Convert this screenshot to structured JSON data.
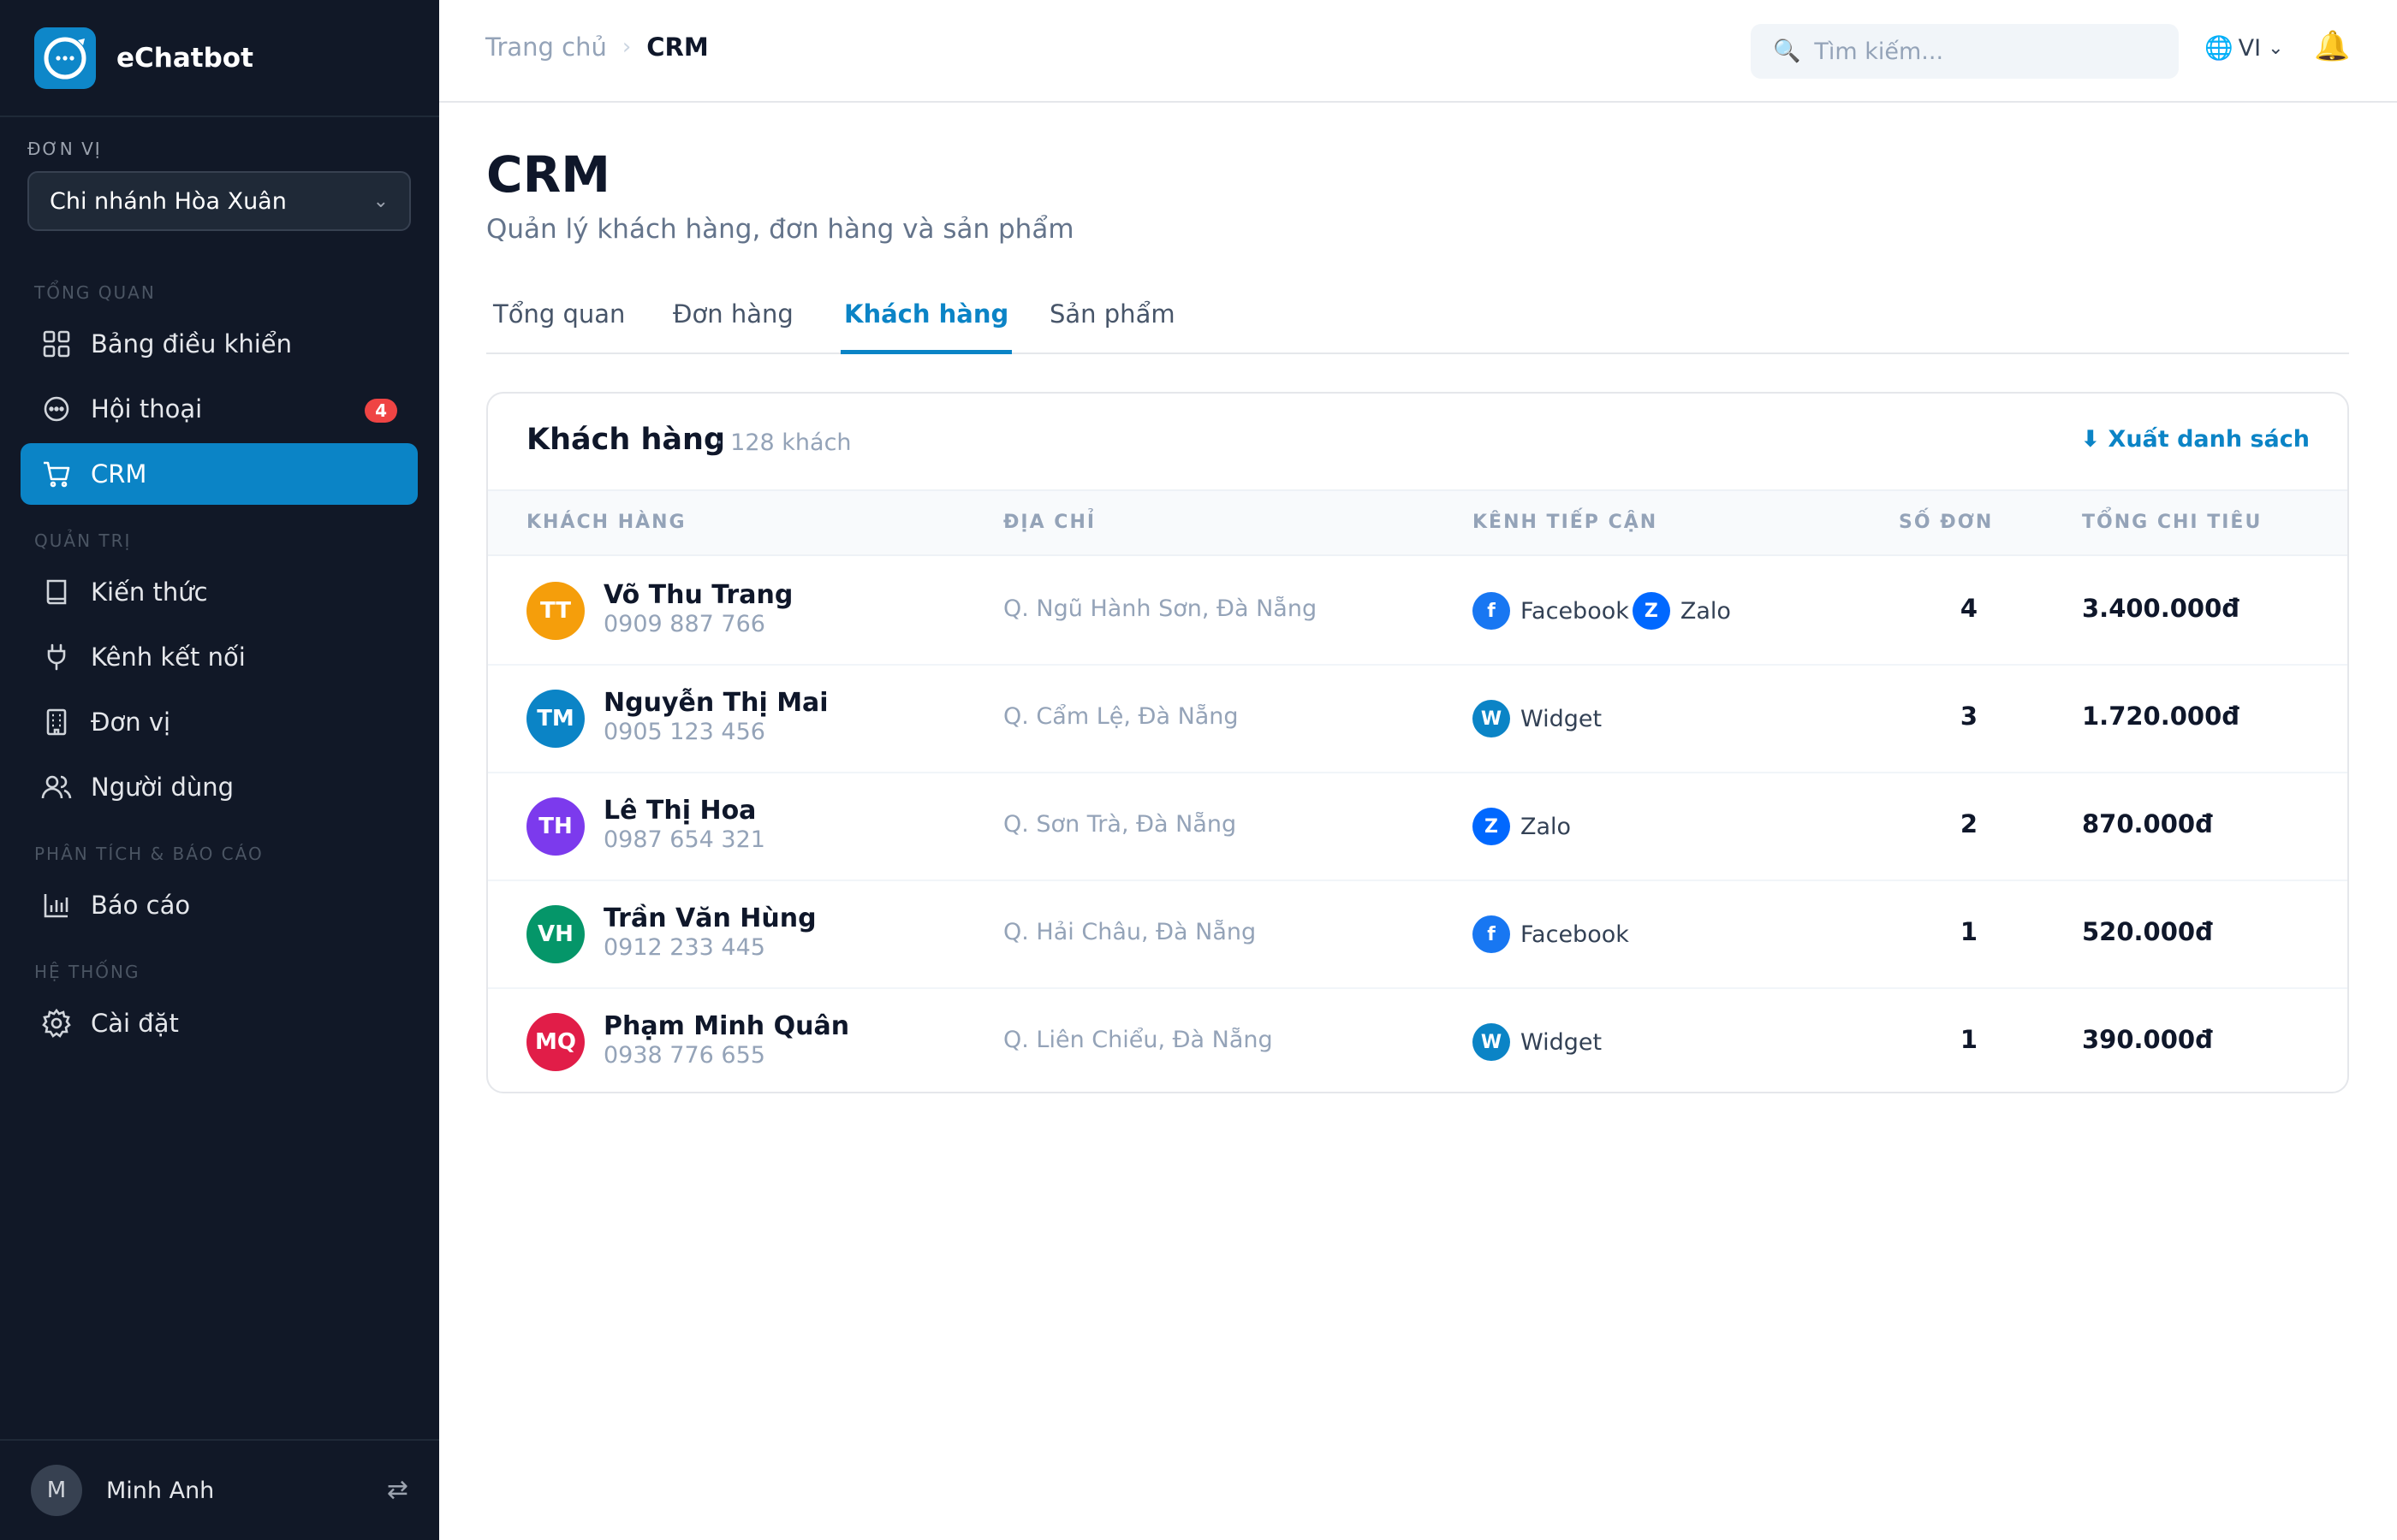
{
  "app": {
    "name": "eChatbot"
  },
  "sidebar": {
    "unit_label": "ĐƠN VỊ",
    "unit_value": "Chi nhánh Hòa Xuân",
    "sections": {
      "overview": "TỔNG QUAN",
      "admin": "QUẢN TRỊ",
      "analytics": "PHÂN TÍCH & BÁO CÁO",
      "system": "HỆ THỐNG"
    },
    "items": {
      "dashboard": "Bảng điều khiển",
      "conversations": "Hội thoại",
      "conversations_badge": "4",
      "crm": "CRM",
      "knowledge": "Kiến thức",
      "channels": "Kênh kết nối",
      "units": "Đơn vị",
      "users": "Người dùng",
      "reports": "Báo cáo",
      "settings": "Cài đặt"
    },
    "user": {
      "initial": "M",
      "name": "Minh Anh"
    }
  },
  "header": {
    "breadcrumb_home": "Trang chủ",
    "breadcrumb_current": "CRM",
    "search_placeholder": "Tìm kiếm...",
    "language": "VI"
  },
  "page": {
    "title": "CRM",
    "subtitle": "Quản lý khách hàng, đơn hàng và sản phẩm",
    "tabs": [
      "Tổng quan",
      "Đơn hàng",
      "Khách hàng",
      "Sản phẩm"
    ],
    "active_tab": "Khách hàng"
  },
  "customers": {
    "title": "Khách hàng",
    "count": "· 128 khách",
    "export_label": "⬇ Xuất danh sách",
    "columns": [
      "KHÁCH HÀNG",
      "ĐỊA CHỈ",
      "KÊNH TIẾP CẬN",
      "SỐ ĐƠN",
      "TỔNG CHI TIÊU"
    ],
    "rows": [
      {
        "initials": "TT",
        "avatar_color": "#f59e0b",
        "name": "Võ Thu Trang",
        "phone": "0909 887 766",
        "address": "Q. Ngũ Hành Sơn, Đà Nẵng",
        "channels": [
          "Facebook",
          "Zalo"
        ],
        "orders": "4",
        "total": "3.400.000đ"
      },
      {
        "initials": "TM",
        "avatar_color": "#0b84c6",
        "name": "Nguyễn Thị Mai",
        "phone": "0905 123 456",
        "address": "Q. Cẩm Lệ, Đà Nẵng",
        "channels": [
          "Widget"
        ],
        "orders": "3",
        "total": "1.720.000đ"
      },
      {
        "initials": "TH",
        "avatar_color": "#7c3aed",
        "name": "Lê Thị Hoa",
        "phone": "0987 654 321",
        "address": "Q. Sơn Trà, Đà Nẵng",
        "channels": [
          "Zalo"
        ],
        "orders": "2",
        "total": "870.000đ"
      },
      {
        "initials": "VH",
        "avatar_color": "#059669",
        "name": "Trần Văn Hùng",
        "phone": "0912 233 445",
        "address": "Q. Hải Châu, Đà Nẵng",
        "channels": [
          "Facebook"
        ],
        "orders": "1",
        "total": "520.000đ"
      },
      {
        "initials": "MQ",
        "avatar_color": "#e11d48",
        "name": "Phạm Minh Quân",
        "phone": "0938 776 655",
        "address": "Q. Liên Chiểu, Đà Nẵng",
        "channels": [
          "Widget"
        ],
        "orders": "1",
        "total": "390.000đ"
      }
    ]
  },
  "channel_styles": {
    "Facebook": {
      "letter": "f",
      "color": "#1877f2"
    },
    "Zalo": {
      "letter": "Z",
      "color": "#0068ff"
    },
    "Widget": {
      "letter": "W",
      "color": "#0b84c6"
    }
  },
  "colors": {
    "accent": "#0b84c6",
    "sidebar_bg": "#111827",
    "badge": "#ef4444"
  }
}
